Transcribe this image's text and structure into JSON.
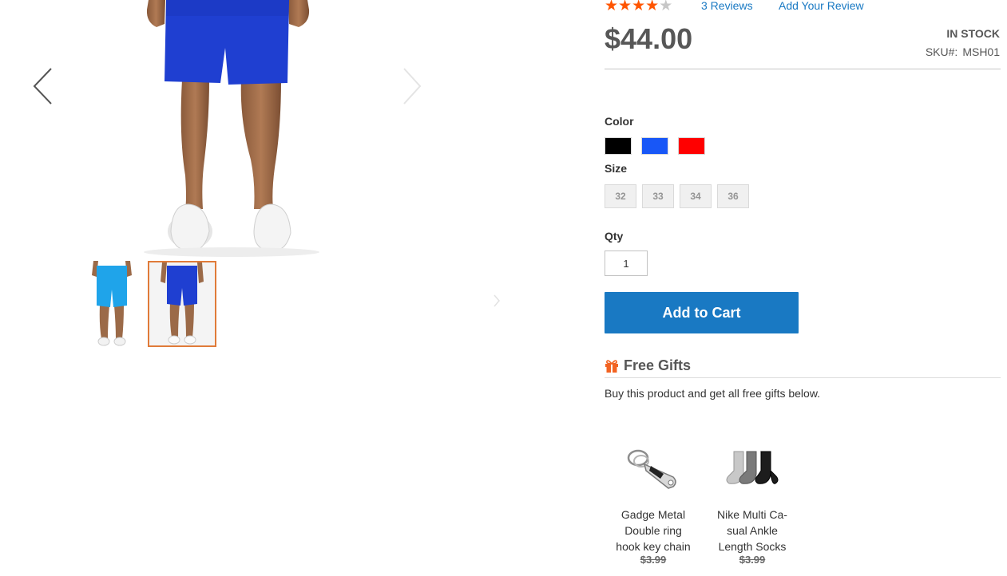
{
  "rating": {
    "stars_filled": 4,
    "stars_total": 5
  },
  "reviews": {
    "count_label": "3 Reviews",
    "add_label": "Add Your Review"
  },
  "product": {
    "price": "$44.00",
    "stock": "IN STOCK",
    "sku_label": "SKU#:",
    "sku": "MSH01"
  },
  "options": {
    "color_label": "Color",
    "colors": [
      {
        "name": "black",
        "hex": "#000000"
      },
      {
        "name": "blue",
        "hex": "#1857f7"
      },
      {
        "name": "red",
        "hex": "#ff0000"
      }
    ],
    "size_label": "Size",
    "sizes": [
      "32",
      "33",
      "34",
      "36"
    ]
  },
  "qty": {
    "label": "Qty",
    "value": "1"
  },
  "cart": {
    "button_label": "Add to Cart"
  },
  "gifts": {
    "icon": "gift-icon",
    "title": "Free Gifts",
    "description": "Buy this product and get all free gifts below.",
    "items": [
      {
        "name_lines": [
          "Gadge Metal",
          "Double ring",
          "hook key chain"
        ],
        "price": "$3.99"
      },
      {
        "name_lines": [
          "Nike Multi Ca-",
          "sual Ankle",
          "Length Socks"
        ],
        "price": "$3.99"
      }
    ]
  },
  "colors": {
    "accent": "#1979c3",
    "star": "#ff5501",
    "thumb_active": "#e07b39",
    "shorts_blue": "#1f3fd1",
    "shorts_cyan": "#1fa4ea"
  },
  "icons": {
    "prev": "chevron-left-icon",
    "next": "chevron-right-icon"
  }
}
